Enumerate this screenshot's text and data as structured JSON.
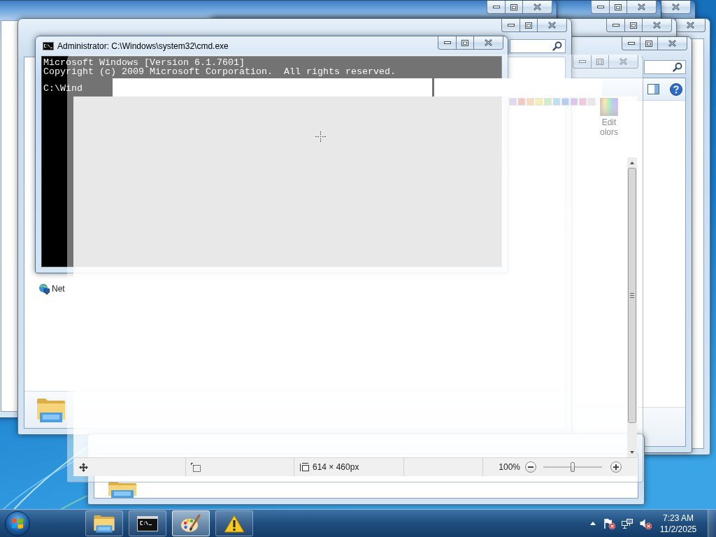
{
  "cmd_window": {
    "title": "Administrator: C:\\Windows\\system32\\cmd.exe",
    "output_lines": [
      "Microsoft Windows [Version 6.1.7601]",
      "Copyright (c) 2009 Microsoft Corporation.  All rights reserved."
    ],
    "prompt": "C:\\Wind"
  },
  "explorer_window": {
    "navigation_items": [
      {
        "label": "Net"
      }
    ]
  },
  "paint_window": {
    "edit_colors_button": {
      "label_lines": [
        "Edit",
        "olors"
      ]
    },
    "status_bar": {
      "image_size": "614 × 460px",
      "zoom": "100%",
      "zoom_slider": {
        "level": 0.5
      }
    }
  },
  "taskbar": {
    "buttons": [
      {
        "kind": "explorer",
        "selected": false
      },
      {
        "kind": "cmd",
        "selected": false
      },
      {
        "kind": "paint",
        "selected": true
      },
      {
        "kind": "warning",
        "selected": false
      }
    ],
    "tray": {
      "action_center_alert": true,
      "volume_muted": true
    },
    "clock": {
      "time": "7:23 AM",
      "date": "11/2/2025"
    }
  }
}
